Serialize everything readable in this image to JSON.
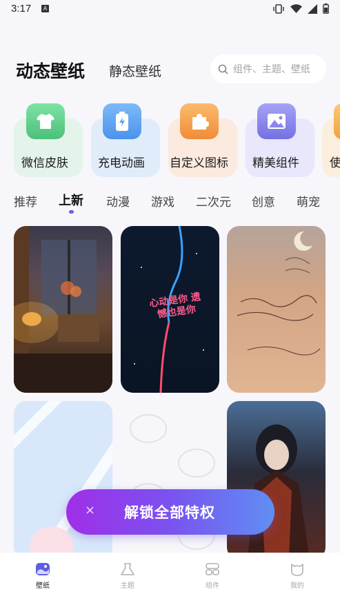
{
  "status_bar": {
    "time": "3:17",
    "notification": "A"
  },
  "header": {
    "tab_dynamic": "动态壁纸",
    "tab_static": "静态壁纸",
    "search_placeholder": "组件、主题、壁纸"
  },
  "categories": [
    {
      "label": "微信皮肤",
      "icon": "shirt-icon",
      "color": "#5fd08a"
    },
    {
      "label": "充电动画",
      "icon": "battery-icon",
      "color": "#5aa6f2"
    },
    {
      "label": "自定义图标",
      "icon": "puzzle-icon",
      "color": "#f6a24f"
    },
    {
      "label": "精美组件",
      "icon": "image-icon",
      "color": "#8a86ee"
    },
    {
      "label": "使",
      "icon": "partial-icon",
      "color": "#f3b35a"
    }
  ],
  "sub_tabs": [
    "推荐",
    "上新",
    "动漫",
    "游戏",
    "二次元",
    "创意",
    "萌宠"
  ],
  "active_sub_tab": "上新",
  "wallpaper_text": {
    "wp2": "心动是你 遗憾也是你"
  },
  "unlock_button": {
    "label": "解锁全部特权",
    "close": "×"
  },
  "bottom_nav": [
    {
      "label": "壁纸",
      "icon": "wallpaper-icon",
      "active": true
    },
    {
      "label": "主题",
      "icon": "theme-icon",
      "active": false
    },
    {
      "label": "组件",
      "icon": "widget-icon",
      "active": false
    },
    {
      "label": "我的",
      "icon": "profile-icon",
      "active": false
    }
  ],
  "colors": {
    "accent": "#6a5de4",
    "unlock_start": "#a02fe8",
    "unlock_end": "#5f8ff3"
  }
}
